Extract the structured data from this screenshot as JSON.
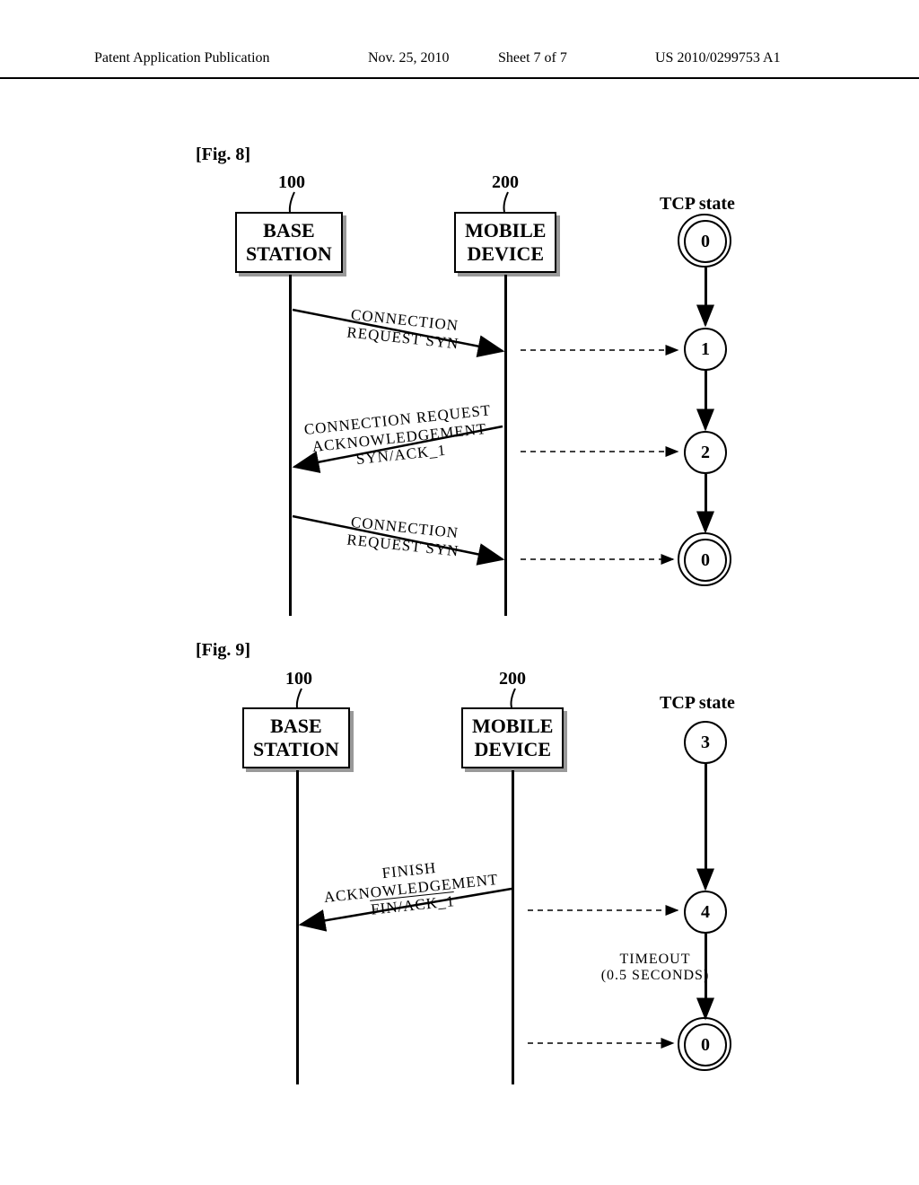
{
  "header": {
    "left": "Patent Application Publication",
    "date": "Nov. 25, 2010",
    "sheet": "Sheet 7 of 7",
    "pubno": "US 2010/0299753 A1"
  },
  "fig8": {
    "label": "[Fig. 8]",
    "base_num": "100",
    "mobile_num": "200",
    "base_title_l1": "BASE",
    "base_title_l2": "STATION",
    "mobile_title_l1": "MOBILE",
    "mobile_title_l2": "DEVICE",
    "tcp_state": "TCP  state",
    "s0a": "0",
    "s1": "1",
    "s2": "2",
    "s0b": "0",
    "msg1_l1": "CONNECTION",
    "msg1_l2": "REQUEST SYN",
    "msg2_l1": "CONNECTION REQUEST",
    "msg2_l2": "ACKNOWLEDGEMENT",
    "msg2_l3": "SYN/ACK_1",
    "msg3_l1": "CONNECTION",
    "msg3_l2": "REQUEST SYN"
  },
  "fig9": {
    "label": "[Fig. 9]",
    "base_num": "100",
    "mobile_num": "200",
    "base_title_l1": "BASE",
    "base_title_l2": "STATION",
    "mobile_title_l1": "MOBILE",
    "mobile_title_l2": "DEVICE",
    "tcp_state": "TCP  state",
    "s3": "3",
    "s4": "4",
    "s0": "0",
    "msg1_l1": "FINISH",
    "msg1_l2": "ACKNOWLEDGEMENT",
    "msg1_l3": "FIN/ACK_1",
    "timeout_l1": "TIMEOUT",
    "timeout_l2": "(0.5 SECONDS)"
  }
}
